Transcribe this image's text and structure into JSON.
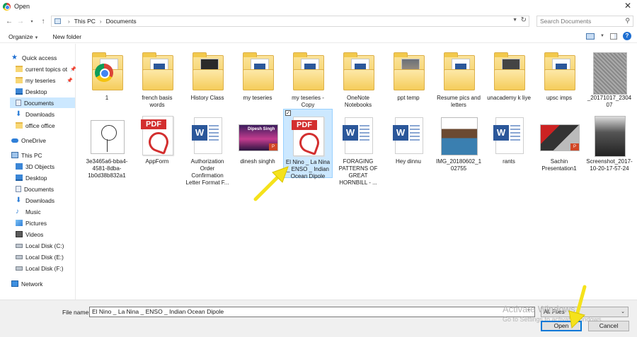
{
  "window": {
    "title": "Open"
  },
  "address": {
    "crumbs": [
      "This PC",
      "Documents"
    ]
  },
  "search": {
    "placeholder": "Search Documents"
  },
  "toolbar": {
    "organize": "Organize",
    "new_folder": "New folder"
  },
  "sidebar": {
    "items": [
      {
        "label": "Quick access",
        "icon": "star-icon"
      },
      {
        "label": "current topics ot",
        "icon": "folder-icon",
        "pinned": true
      },
      {
        "label": "my teseries",
        "icon": "folder-icon",
        "pinned": true
      },
      {
        "label": "Desktop",
        "icon": "desktop-icon"
      },
      {
        "label": "Documents",
        "icon": "documents-icon",
        "selected": true
      },
      {
        "label": "Downloads",
        "icon": "download-icon"
      },
      {
        "label": "office office",
        "icon": "folder-icon"
      },
      {
        "label": "OneDrive",
        "icon": "cloud-icon"
      },
      {
        "label": "This PC",
        "icon": "computer-icon"
      },
      {
        "label": "3D Objects",
        "icon": "objects-3d-icon"
      },
      {
        "label": "Desktop",
        "icon": "desktop-icon"
      },
      {
        "label": "Documents",
        "icon": "documents-icon"
      },
      {
        "label": "Downloads",
        "icon": "download-icon"
      },
      {
        "label": "Music",
        "icon": "music-icon"
      },
      {
        "label": "Pictures",
        "icon": "pictures-icon"
      },
      {
        "label": "Videos",
        "icon": "videos-icon"
      },
      {
        "label": "Local Disk (C:)",
        "icon": "disk-icon"
      },
      {
        "label": "Local Disk (E:)",
        "icon": "disk-icon"
      },
      {
        "label": "Local Disk (F:)",
        "icon": "disk-icon"
      },
      {
        "label": "Network",
        "icon": "network-icon"
      }
    ]
  },
  "files": {
    "row1": [
      "1",
      "french basis words",
      "History Class",
      "my teseries",
      "my teseries - Copy",
      "OneNote Notebooks",
      "ppt temp",
      "Resume pics and letters",
      "unacademy k liye",
      "upsc imps",
      "_20171017_230407"
    ],
    "row2": [
      "3e3465a6-bba4-4581-8dba-1b0d38b832a1",
      "AppForm",
      "Authorization Order Confirmation Letter Format F...",
      "dinesh singhh",
      "El Nino _ La Nina _ ENSO _ Indian Ocean Dipole",
      "FORAGING PATTERNS OF GREAT HORNBILL - ...",
      "Hey dinnu",
      "IMG_20180602_102755",
      "rants",
      "Sachin Presentation1",
      "Screenshot_2017-10-20-17-57-24"
    ],
    "thumb_text": {
      "dinesh": "Dipesh Singh",
      "pdf": "PDF",
      "word": "W"
    },
    "selected": "El Nino _ La Nina _ ENSO _ Indian Ocean Dipole"
  },
  "footer": {
    "file_name_label": "File name:",
    "file_name_value": "El Nino _ La Nina _ ENSO _ Indian Ocean Dipole",
    "file_type": "All Files",
    "open": "Open",
    "cancel": "Cancel",
    "watermark_line1": "Activate Windows",
    "watermark_line2": "Go to Settings to activate Windows."
  },
  "colors": {
    "selection": "#cce8ff",
    "accent": "#0078d7",
    "arrow": "#f5e21b"
  }
}
